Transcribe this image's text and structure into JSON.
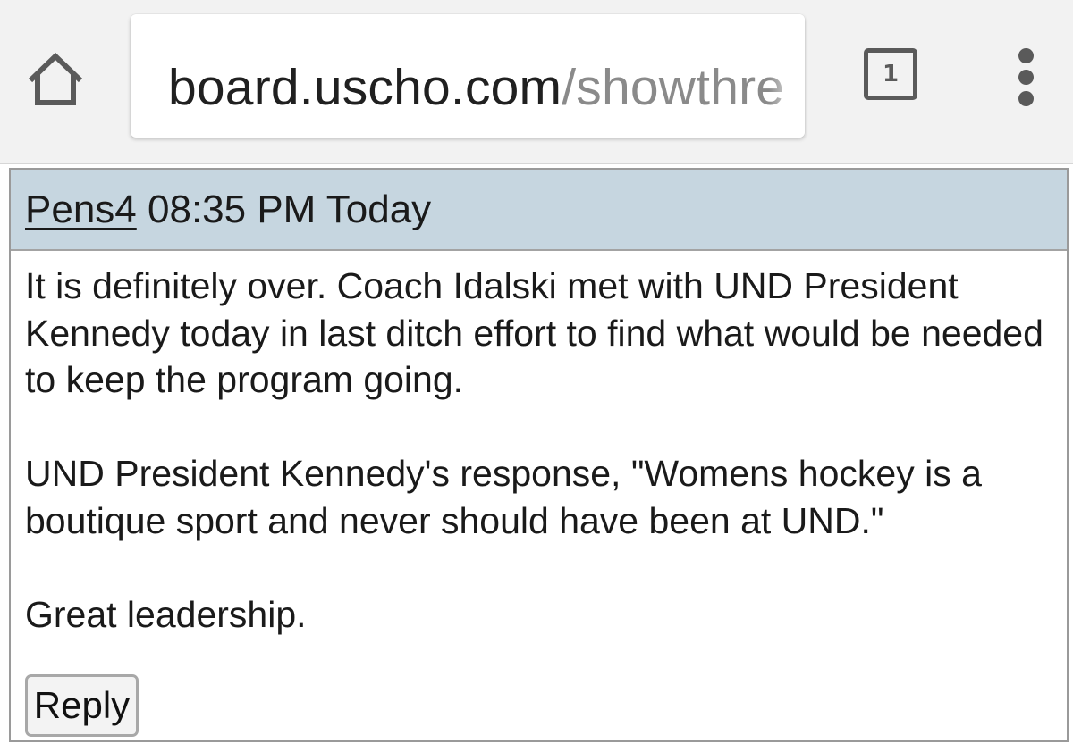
{
  "browser": {
    "home_icon": "home-icon",
    "url_host": "board.uscho.com",
    "url_path": "/showthre",
    "tab_count": "1",
    "menu_icon": "overflow-menu-icon"
  },
  "post": {
    "username": "Pens4",
    "timestamp": "08:35 PM Today",
    "header_bg": "#c6d6e0",
    "paragraphs": [
      "It is definitely over. Coach Idalski met with UND President Kennedy today in last ditch effort to find what would be needed to keep the program going.",
      "UND President Kennedy's response, \"Womens hockey is a boutique sport and never should have been at UND.\"",
      "Great leadership."
    ],
    "reply_label": "Reply"
  }
}
